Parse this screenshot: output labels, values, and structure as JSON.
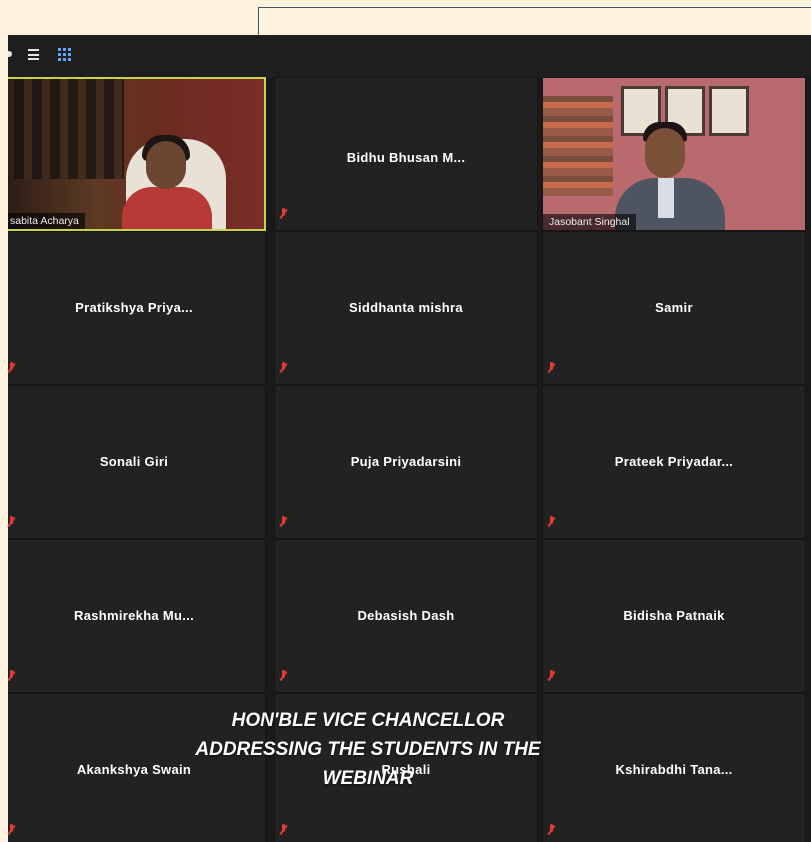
{
  "participants": {
    "active_speaker": "sabita Acharya",
    "video_user_2": "Jasobant Singhal",
    "tiles": [
      "Bidhu Bhusan M...",
      "Pratikshya Priya...",
      "Siddhanta mishra",
      "Samir",
      "Sonali Giri",
      "Puja Priyadarsini",
      "Prateek Priyadar...",
      "Rashmirekha Mu...",
      "Debasish Dash",
      "Bidisha Patnaik",
      "Akankshya Swain",
      "Rushali",
      "Kshirabdhi Tana..."
    ]
  },
  "caption": {
    "line1": "HON'BLE VICE CHANCELLOR",
    "line2": "ADDRESSING THE STUDENTS IN THE",
    "line3": "WEBINAR"
  },
  "toolbar": {
    "icons": [
      "speaker-view-icon",
      "gallery-view-icon"
    ],
    "accent": "#5aa9ff"
  },
  "colors": {
    "page_bg": "#fdf2de",
    "tile_bg": "#222222",
    "active_border": "#c5d44a",
    "mute": "#e53935"
  }
}
